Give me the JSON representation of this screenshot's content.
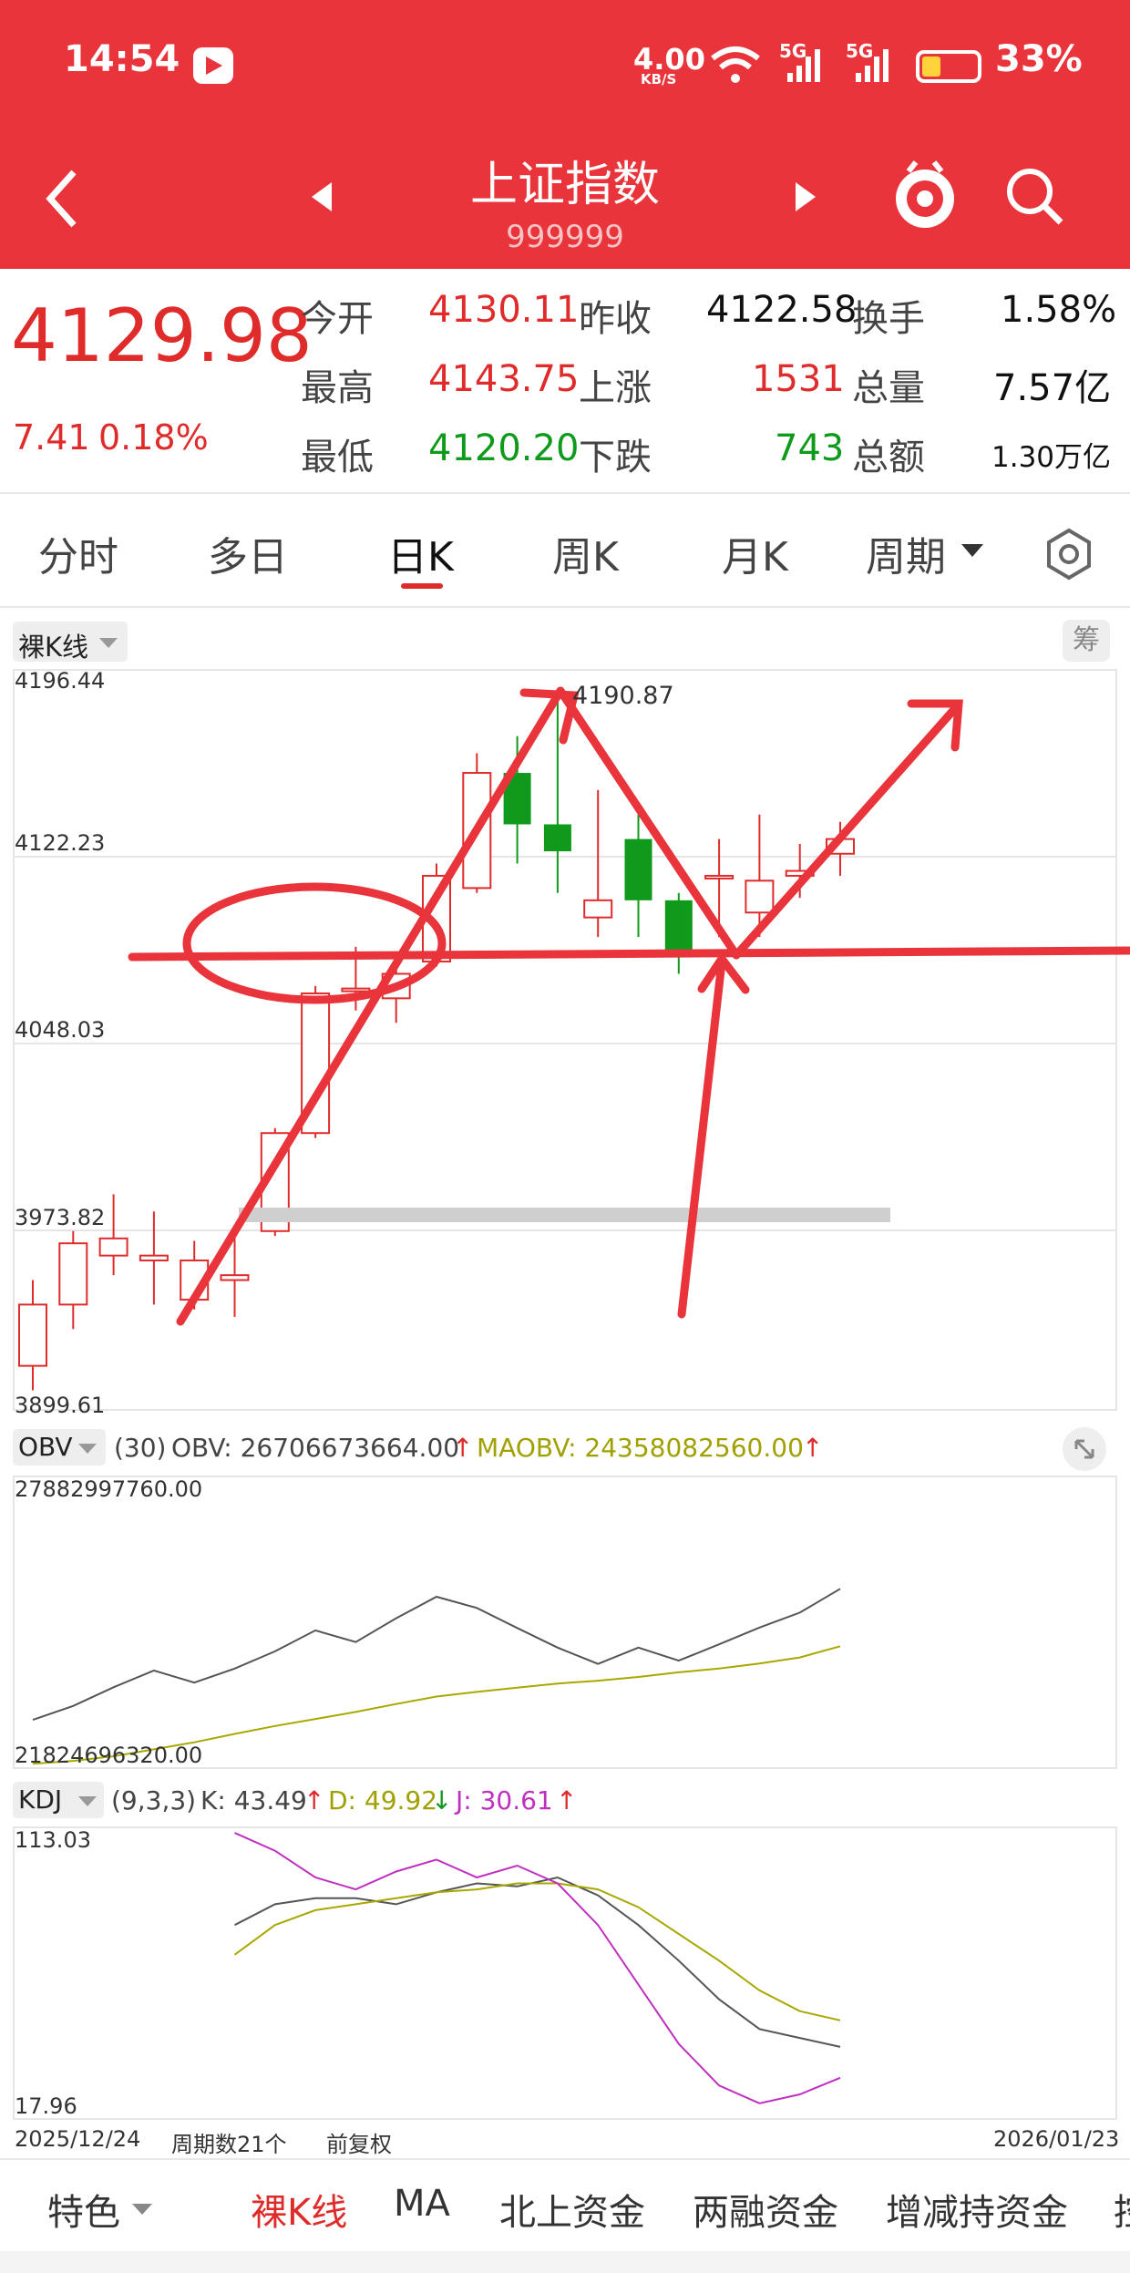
{
  "status": {
    "time": "14:54",
    "speed_value": "4.00",
    "speed_unit": "KB/S",
    "net1": "5G",
    "net2": "5G",
    "battery": "33%"
  },
  "header": {
    "title": "上证指数",
    "code": "999999"
  },
  "quote": {
    "price": "4129.98",
    "change": "7.41",
    "change_pct": "0.18%",
    "row1": {
      "l1": "今开",
      "v1": "4130.11",
      "l2": "昨收",
      "v2": "4122.58",
      "l3": "换手",
      "v3": "1.58%"
    },
    "row2": {
      "l1": "最高",
      "v1": "4143.75",
      "l2": "上涨",
      "v2": "1531",
      "l3": "总量",
      "v3": "7.57亿"
    },
    "row3": {
      "l1": "最低",
      "v1": "4120.20",
      "l2": "下跌",
      "v2": "743",
      "l3": "总额",
      "v3": "1.30万亿"
    }
  },
  "tabs": [
    "分时",
    "多日",
    "日K",
    "周K",
    "月K",
    "周期"
  ],
  "kline": {
    "selector": "裸K线",
    "chip_btn": "筹",
    "ticks": [
      "4196.44",
      "4122.23",
      "4048.03",
      "3973.82",
      "3899.61"
    ],
    "high_label": "4190.87"
  },
  "obv": {
    "selector": "OBV",
    "params": "(30)",
    "obv_label": "OBV: 26706673664.00",
    "obv_arrow": "↑",
    "maobv_label": "MAOBV: 24358082560.00",
    "maobv_arrow": "↑",
    "max": "27882997760.00",
    "min": "21824696320.00"
  },
  "kdj": {
    "selector": "KDJ",
    "params": "(9,3,3)",
    "k_label": "K: 43.49",
    "k_arrow": "↑",
    "d_label": "D: 49.92",
    "d_arrow": "↓",
    "j_label": "J: 30.61",
    "j_arrow": "↑",
    "max": "113.03",
    "min": "17.96"
  },
  "footer": {
    "start_date": "2025/12/24",
    "period_count": "周期数21个",
    "adjust": "前复权",
    "end_date": "2026/01/23"
  },
  "bottom_tabs": [
    "特色",
    "裸K线",
    "MA",
    "北上资金",
    "两融资金",
    "增减持资金",
    "控"
  ],
  "colors": {
    "header_red": "#e8343a",
    "up": "#e02b2b",
    "down": "#0f9a1b"
  },
  "chart_data": [
    {
      "type": "candlestick",
      "title": "上证指数 日K",
      "x": [
        "2025/12/24",
        "",
        "",
        "",
        "",
        "",
        "",
        "",
        "",
        "",
        "",
        "",
        "",
        "",
        "",
        "",
        "",
        "",
        "",
        "",
        "2026/01/23"
      ],
      "ohlc": [
        [
          3915,
          3940,
          3905,
          3950
        ],
        [
          3940,
          3965,
          3930,
          3970
        ],
        [
          3960,
          3967,
          3952,
          3985
        ],
        [
          3958,
          3960,
          3940,
          3978
        ],
        [
          3942,
          3958,
          3938,
          3966
        ],
        [
          3950,
          3952,
          3935,
          3968
        ],
        [
          3970,
          4010,
          3968,
          4012
        ],
        [
          4010,
          4067,
          4008,
          4070
        ],
        [
          4068,
          4069,
          4060,
          4086
        ],
        [
          4065,
          4075,
          4055,
          4082
        ],
        [
          4080,
          4115,
          4078,
          4120
        ],
        [
          4110,
          4157,
          4108,
          4165
        ],
        [
          4157,
          4136,
          4120,
          4172
        ],
        [
          4136,
          4125,
          4108,
          4190.87
        ],
        [
          4098,
          4105,
          4090,
          4150
        ],
        [
          4130,
          4105,
          4090,
          4140
        ],
        [
          4105,
          4082,
          4075,
          4108
        ],
        [
          4115,
          4115,
          4090,
          4130
        ],
        [
          4100,
          4113,
          4090,
          4140
        ],
        [
          4115,
          4117,
          4106,
          4128
        ],
        [
          4124,
          4130,
          4115,
          4137
        ]
      ],
      "ylim": [
        3899.61,
        4196.44
      ]
    },
    {
      "type": "line",
      "title": "OBV",
      "series": [
        {
          "name": "OBV",
          "values": [
            22780,
            23080,
            23480,
            23840,
            23580,
            23880,
            24250,
            24700,
            24450,
            24960,
            25420,
            25180,
            24750,
            24330,
            23980,
            24330,
            24050,
            24400,
            24760,
            25080,
            25590
          ]
        },
        {
          "name": "MAOBV",
          "values": [
            21840,
            21900,
            22000,
            22150,
            22300,
            22480,
            22650,
            22800,
            22950,
            23120,
            23280,
            23380,
            23470,
            23560,
            23620,
            23700,
            23800,
            23880,
            23990,
            24120,
            24360
          ]
        }
      ],
      "ylim": [
        21824696320,
        27882997760
      ],
      "unit": "1e6"
    },
    {
      "type": "line",
      "title": "KDJ",
      "series": [
        {
          "name": "K",
          "values": [
            82,
            89,
            91,
            91,
            89,
            93,
            96,
            95,
            98,
            92,
            82,
            70,
            57,
            47,
            44,
            41
          ]
        },
        {
          "name": "D",
          "values": [
            72,
            82,
            87,
            89,
            91,
            93,
            94,
            96,
            96,
            94,
            88,
            79,
            70,
            60,
            53,
            49.92
          ]
        },
        {
          "name": "J",
          "values": [
            113,
            107,
            98,
            94,
            100,
            104,
            98,
            102,
            96,
            82,
            62,
            42,
            28,
            22,
            25,
            30.61
          ]
        }
      ],
      "ylim": [
        17.96,
        113.03
      ]
    }
  ]
}
